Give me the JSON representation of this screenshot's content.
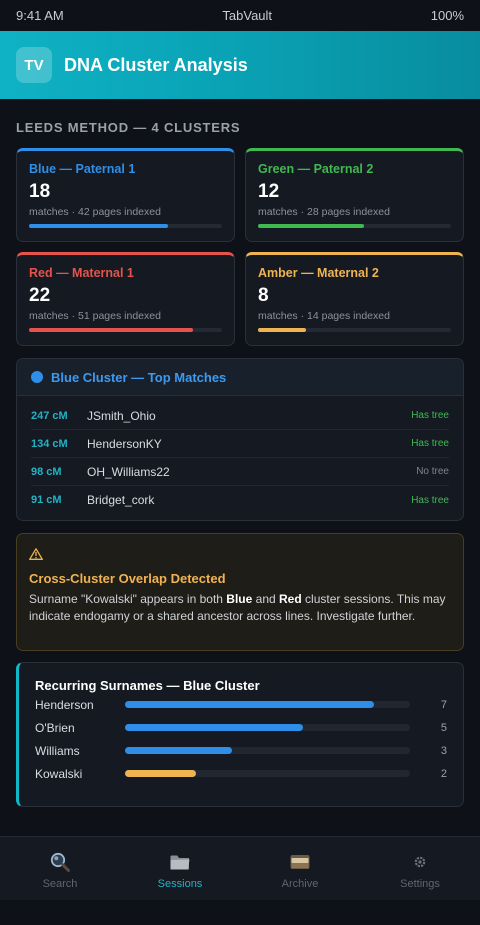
{
  "status_bar": {
    "time": "9:41 AM",
    "app": "TabVault",
    "battery": "100%"
  },
  "header": {
    "logo": "TV",
    "title": "DNA Cluster Analysis"
  },
  "section_label": "LEEDS METHOD — 4 CLUSTERS",
  "clusters": [
    {
      "name": "Blue — Paternal 1",
      "count": "18",
      "meta_prefix": "matches",
      "meta": "42 pages indexed",
      "color": "#2f8ee8",
      "progress": 0.72
    },
    {
      "name": "Green — Paternal 2",
      "count": "12",
      "meta_prefix": "matches",
      "meta": "28 pages indexed",
      "color": "#3fb950",
      "progress": 0.55
    },
    {
      "name": "Red — Maternal 1",
      "count": "22",
      "meta_prefix": "matches",
      "meta": "51 pages indexed",
      "color": "#e5534b",
      "progress": 0.85
    },
    {
      "name": "Amber — Maternal 2",
      "count": "8",
      "meta_prefix": "matches",
      "meta": "14 pages indexed",
      "color": "#f0b352",
      "progress": 0.25
    }
  ],
  "top_matches": {
    "title": "Blue Cluster — Top Matches",
    "dot_color": "#2f8ee8",
    "rows": [
      {
        "cm": "247 cM",
        "name": "JSmith_Ohio",
        "tree": "Has tree",
        "has_tree": true
      },
      {
        "cm": "134 cM",
        "name": "HendersonKY",
        "tree": "Has tree",
        "has_tree": true
      },
      {
        "cm": "98 cM",
        "name": "OH_Williams22",
        "tree": "No tree",
        "has_tree": false
      },
      {
        "cm": "91 cM",
        "name": "Bridget_cork",
        "tree": "Has tree",
        "has_tree": true
      }
    ]
  },
  "alert": {
    "icon": "warning-icon",
    "title": "Cross-Cluster Overlap Detected",
    "text_1": "Surname \"Kowalski\" appears in both ",
    "bold_1": "Blue",
    "text_2": " and ",
    "bold_2": "Red",
    "text_3": " cluster sessions. This may indicate endogamy or a shared ancestor across lines. Investigate further."
  },
  "surnames": {
    "title": "Recurring Surnames — Blue Cluster",
    "max": 8,
    "rows": [
      {
        "name": "Henderson",
        "count": 7,
        "color": "#2f8ee8"
      },
      {
        "name": "O'Brien",
        "count": 5,
        "color": "#2f8ee8"
      },
      {
        "name": "Williams",
        "count": 3,
        "color": "#2f8ee8"
      },
      {
        "name": "Kowalski",
        "count": 2,
        "color": "#f0b352"
      }
    ]
  },
  "nav": [
    {
      "label": "Search",
      "icon": "magnifier-icon",
      "active": false
    },
    {
      "label": "Sessions",
      "icon": "folder-icon",
      "active": true
    },
    {
      "label": "Archive",
      "icon": "archive-box-icon",
      "active": false
    },
    {
      "label": "Settings",
      "icon": "gear-icon",
      "active": false
    }
  ]
}
